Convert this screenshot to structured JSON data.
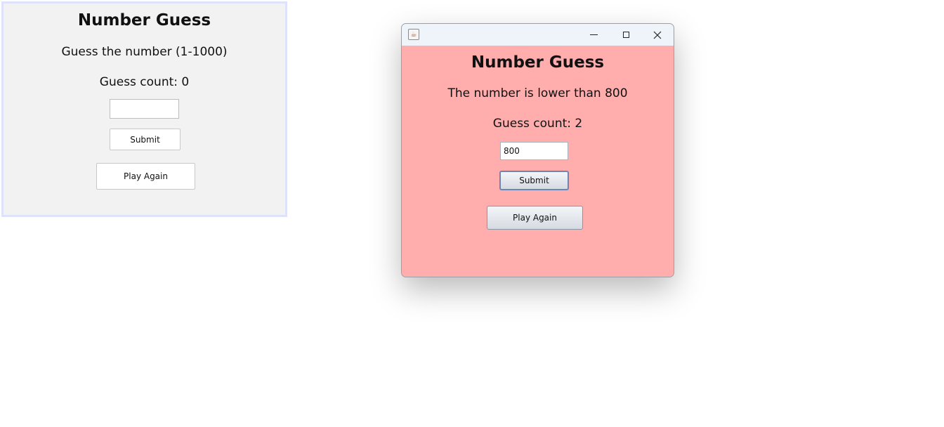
{
  "left_panel": {
    "title": "Number Guess",
    "prompt": "Guess the number (1-1000)",
    "guess_count": "Guess count: 0",
    "input_value": "",
    "submit_label": "Submit",
    "play_again_label": "Play Again"
  },
  "window": {
    "titlebar": {
      "icon": "java-cup-icon",
      "controls": [
        "minimize-icon",
        "maximize-icon",
        "close-icon"
      ]
    },
    "title": "Number Guess",
    "message": "The number is lower than 800",
    "guess_count": "Guess count: 2",
    "input_value": "800",
    "submit_label": "Submit",
    "play_again_label": "Play Again",
    "background_color": "#ffadad"
  }
}
